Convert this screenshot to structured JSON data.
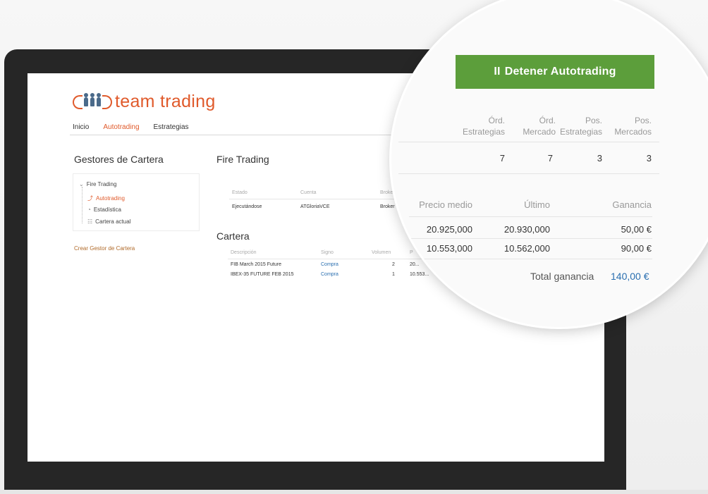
{
  "app": {
    "logo_text": "team trading"
  },
  "nav": {
    "items": [
      "Inicio",
      "Autotrading",
      "Estrategias"
    ]
  },
  "sidebar": {
    "title": "Gestores de Cartera",
    "tree": {
      "root": "Fire Trading",
      "children": [
        "Autotrading",
        "Estadística",
        "Cartera actual"
      ]
    },
    "create_link": "Crear Gestor de Cartera"
  },
  "main": {
    "title": "Fire Trading",
    "status_table": {
      "headers": [
        "Estado",
        "Cuenta",
        "Broker"
      ],
      "row": [
        "Ejecutándose",
        "ATGloriaVCE",
        "Broker"
      ]
    },
    "cartera": {
      "title": "Cartera",
      "headers": [
        "Descripción",
        "Signo",
        "Volumen",
        "P"
      ],
      "rows": [
        [
          "FIB March 2015 Future",
          "Compra",
          "2",
          "20..."
        ],
        [
          "IBEX-35 FUTURE FEB 2015",
          "Compra",
          "1",
          "10.553..."
        ]
      ]
    }
  },
  "magnifier": {
    "stop_button": {
      "icon": "pause-icon",
      "icon_glyph": "II",
      "label": "Detener Autotrading",
      "color": "#5c9e3b"
    },
    "counts": {
      "headers": [
        [
          "Órd.",
          "Estrategias"
        ],
        [
          "Órd.",
          "Mercado"
        ],
        [
          "Pos.",
          "Estrategias"
        ],
        [
          "Pos.",
          "Mercados"
        ]
      ],
      "values": [
        "7",
        "7",
        "3",
        "3"
      ]
    },
    "prices": {
      "headers": [
        "Precio medio",
        "Último",
        "Ganancia"
      ],
      "rows": [
        [
          "20.925,000",
          "20.930,000",
          "50,00 €"
        ],
        [
          "10.553,000",
          "10.562,000",
          "90,00 €"
        ]
      ],
      "total_label": "Total ganancia",
      "total_value": "140,00 €"
    }
  },
  "colors": {
    "accent_orange": "#e05a2b",
    "link_blue": "#2a6fb0",
    "button_green": "#5c9e3b"
  }
}
